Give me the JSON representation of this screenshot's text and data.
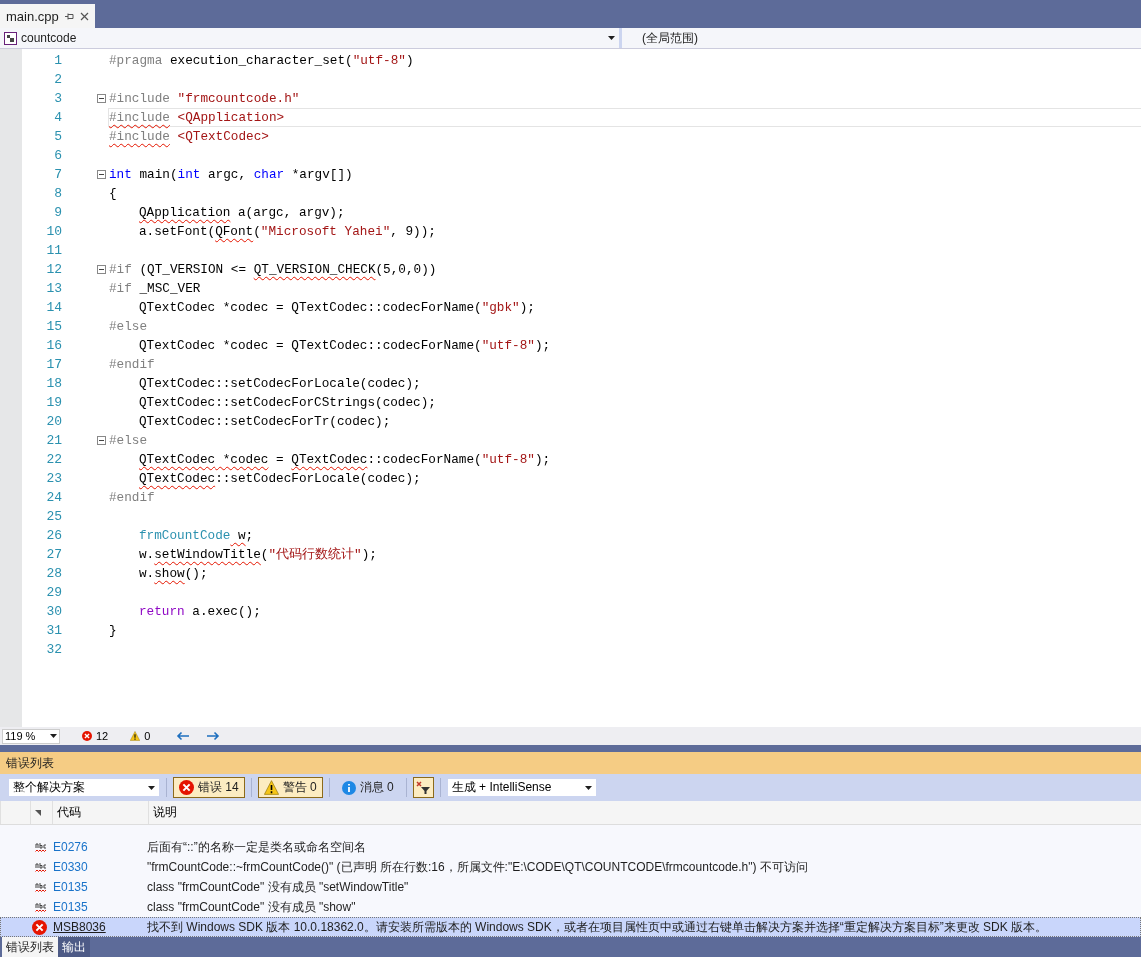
{
  "editor_tabs": [
    {
      "label": "main.cpp",
      "selected": true
    }
  ],
  "nav_bar": {
    "project": "countcode",
    "scope": "(全局范围)"
  },
  "code_lines": [
    {
      "n": "1",
      "fold": false,
      "current": false,
      "indented": false,
      "tokens": [
        {
          "text": "#pragma",
          "kind": "preproc"
        },
        {
          "text": " execution_character_set(",
          "kind": "plain"
        },
        {
          "text": "\"utf-8\"",
          "kind": "string"
        },
        {
          "text": ")",
          "kind": "plain"
        }
      ]
    },
    {
      "n": "2",
      "fold": false,
      "current": false
    },
    {
      "n": "3",
      "fold": true,
      "current": false,
      "indented": false,
      "tokens": [
        {
          "text": "#include",
          "kind": "preproc"
        },
        {
          "text": " \"frmcountcode.h\"",
          "kind": "string"
        }
      ]
    },
    {
      "n": "4",
      "fold": false,
      "current": true,
      "indented": false,
      "tokens": [
        {
          "text": "#include",
          "kind": "preproc",
          "squiggle": true
        },
        {
          "text": " <QApplication>",
          "kind": "string"
        }
      ]
    },
    {
      "n": "5",
      "fold": false,
      "current": false,
      "indented": false,
      "tokens": [
        {
          "text": "#include",
          "kind": "preproc",
          "squiggle": true
        },
        {
          "text": " <QTextCodec>",
          "kind": "string"
        }
      ]
    },
    {
      "n": "6",
      "fold": false,
      "current": false
    },
    {
      "n": "7",
      "fold": true,
      "current": false,
      "indented": false,
      "tokens": [
        {
          "text": "int",
          "kind": "keyword"
        },
        {
          "text": " main(",
          "kind": "plain"
        },
        {
          "text": "int",
          "kind": "keyword"
        },
        {
          "text": " argc, ",
          "kind": "plain"
        },
        {
          "text": "char",
          "kind": "keyword"
        },
        {
          "text": " *argv[])",
          "kind": "plain"
        }
      ]
    },
    {
      "n": "8",
      "fold": false,
      "current": false,
      "indented": false,
      "tokens": [
        {
          "text": "{",
          "kind": "plain"
        }
      ]
    },
    {
      "n": "9",
      "fold": false,
      "current": false,
      "indented": true,
      "tokens": [
        {
          "text": "QApplication",
          "kind": "plain",
          "squiggle": true
        },
        {
          "text": " a(argc, argv);",
          "kind": "plain"
        }
      ]
    },
    {
      "n": "10",
      "fold": false,
      "current": false,
      "indented": true,
      "tokens": [
        {
          "text": "a.setFont(",
          "kind": "plain"
        },
        {
          "text": "QFont",
          "kind": "plain",
          "squiggle": true
        },
        {
          "text": "(",
          "kind": "plain"
        },
        {
          "text": "\"Microsoft Yahei\"",
          "kind": "string"
        },
        {
          "text": ", 9));",
          "kind": "plain"
        }
      ]
    },
    {
      "n": "11",
      "fold": false,
      "current": false
    },
    {
      "n": "12",
      "fold": true,
      "current": false,
      "indented": false,
      "tokens": [
        {
          "text": "#if",
          "kind": "preproc"
        },
        {
          "text": " (QT_VERSION <= ",
          "kind": "plain"
        },
        {
          "text": "QT_VERSION_CHECK",
          "kind": "plain",
          "squiggle": true
        },
        {
          "text": "(5,0,0))",
          "kind": "plain"
        }
      ]
    },
    {
      "n": "13",
      "fold": false,
      "current": false,
      "indented": false,
      "tokens": [
        {
          "text": "#if",
          "kind": "preproc"
        },
        {
          "text": " _MSC_VER",
          "kind": "plain"
        }
      ]
    },
    {
      "n": "14",
      "fold": false,
      "current": false,
      "indented": true,
      "tokens": [
        {
          "text": "QTextCodec *codec = QTextCodec::codecForName(",
          "kind": "plain"
        },
        {
          "text": "\"gbk\"",
          "kind": "string"
        },
        {
          "text": ");",
          "kind": "plain"
        }
      ]
    },
    {
      "n": "15",
      "fold": false,
      "current": false,
      "indented": false,
      "tokens": [
        {
          "text": "#else",
          "kind": "preproc"
        }
      ]
    },
    {
      "n": "16",
      "fold": false,
      "current": false,
      "indented": true,
      "tokens": [
        {
          "text": "QTextCodec *codec = QTextCodec::codecForName(",
          "kind": "plain"
        },
        {
          "text": "\"utf-8\"",
          "kind": "string"
        },
        {
          "text": ");",
          "kind": "plain"
        }
      ]
    },
    {
      "n": "17",
      "fold": false,
      "current": false,
      "indented": false,
      "tokens": [
        {
          "text": "#endif",
          "kind": "preproc"
        }
      ]
    },
    {
      "n": "18",
      "fold": false,
      "current": false,
      "indented": true,
      "tokens": [
        {
          "text": "QTextCodec::setCodecForLocale(codec);",
          "kind": "plain"
        }
      ]
    },
    {
      "n": "19",
      "fold": false,
      "current": false,
      "indented": true,
      "tokens": [
        {
          "text": "QTextCodec::setCodecForCStrings(codec);",
          "kind": "plain"
        }
      ]
    },
    {
      "n": "20",
      "fold": false,
      "current": false,
      "indented": true,
      "tokens": [
        {
          "text": "QTextCodec::setCodecForTr(codec);",
          "kind": "plain"
        }
      ]
    },
    {
      "n": "21",
      "fold": true,
      "current": false,
      "indented": false,
      "tokens": [
        {
          "text": "#else",
          "kind": "preproc"
        }
      ]
    },
    {
      "n": "22",
      "fold": false,
      "current": false,
      "indented": true,
      "tokens": [
        {
          "text": "QTextCodec",
          "kind": "plain",
          "squiggle": true
        },
        {
          "text": " *codec",
          "kind": "plain",
          "squiggle": true
        },
        {
          "text": " = ",
          "kind": "plain"
        },
        {
          "text": "QTextCodec",
          "kind": "plain",
          "squiggle": true
        },
        {
          "text": "::codecForName(",
          "kind": "plain"
        },
        {
          "text": "\"utf-8\"",
          "kind": "string"
        },
        {
          "text": ");",
          "kind": "plain"
        }
      ]
    },
    {
      "n": "23",
      "fold": false,
      "current": false,
      "indented": true,
      "tokens": [
        {
          "text": "QTextCodec",
          "kind": "plain",
          "squiggle": true
        },
        {
          "text": "::setCodecForLocale(codec);",
          "kind": "plain"
        }
      ]
    },
    {
      "n": "24",
      "fold": false,
      "current": false,
      "indented": false,
      "tokens": [
        {
          "text": "#endif",
          "kind": "preproc"
        }
      ]
    },
    {
      "n": "25",
      "fold": false,
      "current": false
    },
    {
      "n": "26",
      "fold": false,
      "current": false,
      "indented": true,
      "tokens": [
        {
          "text": "frmCountCode",
          "kind": "type"
        },
        {
          "text": " w",
          "kind": "plain",
          "squiggle": true
        },
        {
          "text": ";",
          "kind": "plain"
        }
      ]
    },
    {
      "n": "27",
      "fold": false,
      "current": false,
      "indented": true,
      "tokens": [
        {
          "text": "w.",
          "kind": "plain"
        },
        {
          "text": "setWindowTitle",
          "kind": "plain",
          "squiggle": true
        },
        {
          "text": "(",
          "kind": "plain"
        },
        {
          "text": "\"代码行数统计\"",
          "kind": "string"
        },
        {
          "text": ");",
          "kind": "plain"
        }
      ]
    },
    {
      "n": "28",
      "fold": false,
      "current": false,
      "indented": true,
      "tokens": [
        {
          "text": "w.",
          "kind": "plain"
        },
        {
          "text": "show",
          "kind": "plain",
          "squiggle": true
        },
        {
          "text": "();",
          "kind": "plain"
        }
      ]
    },
    {
      "n": "29",
      "fold": false,
      "current": false
    },
    {
      "n": "30",
      "fold": false,
      "current": false,
      "indented": true,
      "tokens": [
        {
          "text": "return",
          "kind": "control"
        },
        {
          "text": " a.exec();",
          "kind": "plain"
        }
      ]
    },
    {
      "n": "31",
      "fold": false,
      "current": false,
      "indented": false,
      "tokens": [
        {
          "text": "}",
          "kind": "plain"
        }
      ]
    },
    {
      "n": "32",
      "fold": false,
      "current": false
    }
  ],
  "status_bar": {
    "zoom": "119 %",
    "errors": "12",
    "warnings": "0"
  },
  "error_list": {
    "title": "错误列表",
    "scope": "整个解决方案",
    "filters": [
      {
        "kind": "error",
        "label": "错误 14",
        "selected": true
      },
      {
        "kind": "warning",
        "label": "警告 0",
        "selected": true
      },
      {
        "kind": "info",
        "label": "消息 0",
        "selected": false
      }
    ],
    "source": "生成 + IntelliSense",
    "columns": [
      "代码",
      "说明"
    ],
    "rows": [
      {
        "kind": "spelling",
        "code": "E0276",
        "description": "后面有“::”的名称一定是类名或命名空间名",
        "selected": false
      },
      {
        "kind": "spelling",
        "code": "E0330",
        "description": "\"frmCountCode::~frmCountCode()\" (已声明 所在行数:16，所属文件:\"E:\\CODE\\QT\\COUNTCODE\\frmcountcode.h\") 不可访问",
        "selected": false
      },
      {
        "kind": "spelling",
        "code": "E0135",
        "description": "class \"frmCountCode\" 没有成员 \"setWindowTitle\"",
        "selected": false
      },
      {
        "kind": "spelling",
        "code": "E0135",
        "description": "class \"frmCountCode\" 没有成员 \"show\"",
        "selected": false
      },
      {
        "kind": "error",
        "code": "MSB8036",
        "description": "找不到 Windows SDK 版本 10.0.18362.0。请安装所需版本的 Windows SDK，或者在项目属性页中或通过右键单击解决方案并选择“重定解决方案目标”来更改 SDK 版本。",
        "selected": true
      }
    ]
  },
  "bottom_tabs": [
    {
      "label": "错误列表",
      "selected": true
    },
    {
      "label": "输出",
      "selected": false
    }
  ]
}
